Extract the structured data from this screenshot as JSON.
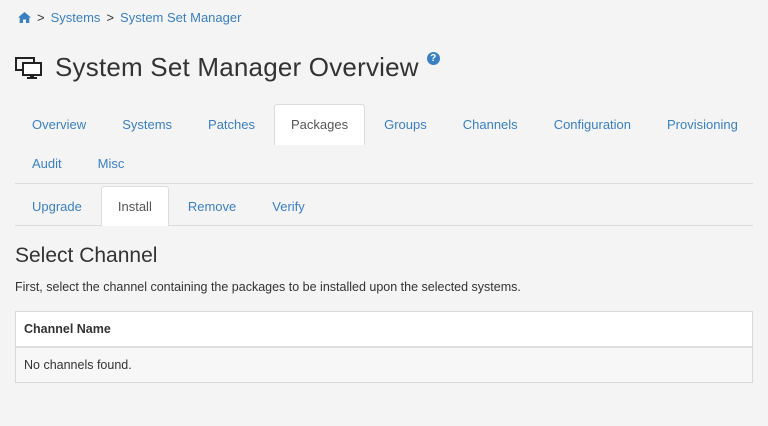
{
  "breadcrumb": {
    "home_icon": "home-icon",
    "separator": ">",
    "items": [
      "Systems",
      "System Set Manager"
    ]
  },
  "header": {
    "icon": "system-set-icon",
    "title": "System Set Manager Overview",
    "help_icon": "question-circle-icon",
    "help_symbol": "?"
  },
  "main_tabs": {
    "row1": [
      "Overview",
      "Systems",
      "Patches",
      "Packages",
      "Groups",
      "Channels",
      "Configuration",
      "Provisioning"
    ],
    "row2": [
      "Audit",
      "Misc"
    ],
    "active": "Packages"
  },
  "sub_tabs": {
    "items": [
      "Upgrade",
      "Install",
      "Remove",
      "Verify"
    ],
    "active": "Install"
  },
  "section": {
    "title": "Select Channel",
    "description": "First, select the channel containing the packages to be installed upon the selected systems."
  },
  "table": {
    "column_header": "Channel Name",
    "empty_message": "No channels found."
  },
  "colors": {
    "link": "#3a7fc1",
    "background": "#f4f4f4"
  }
}
